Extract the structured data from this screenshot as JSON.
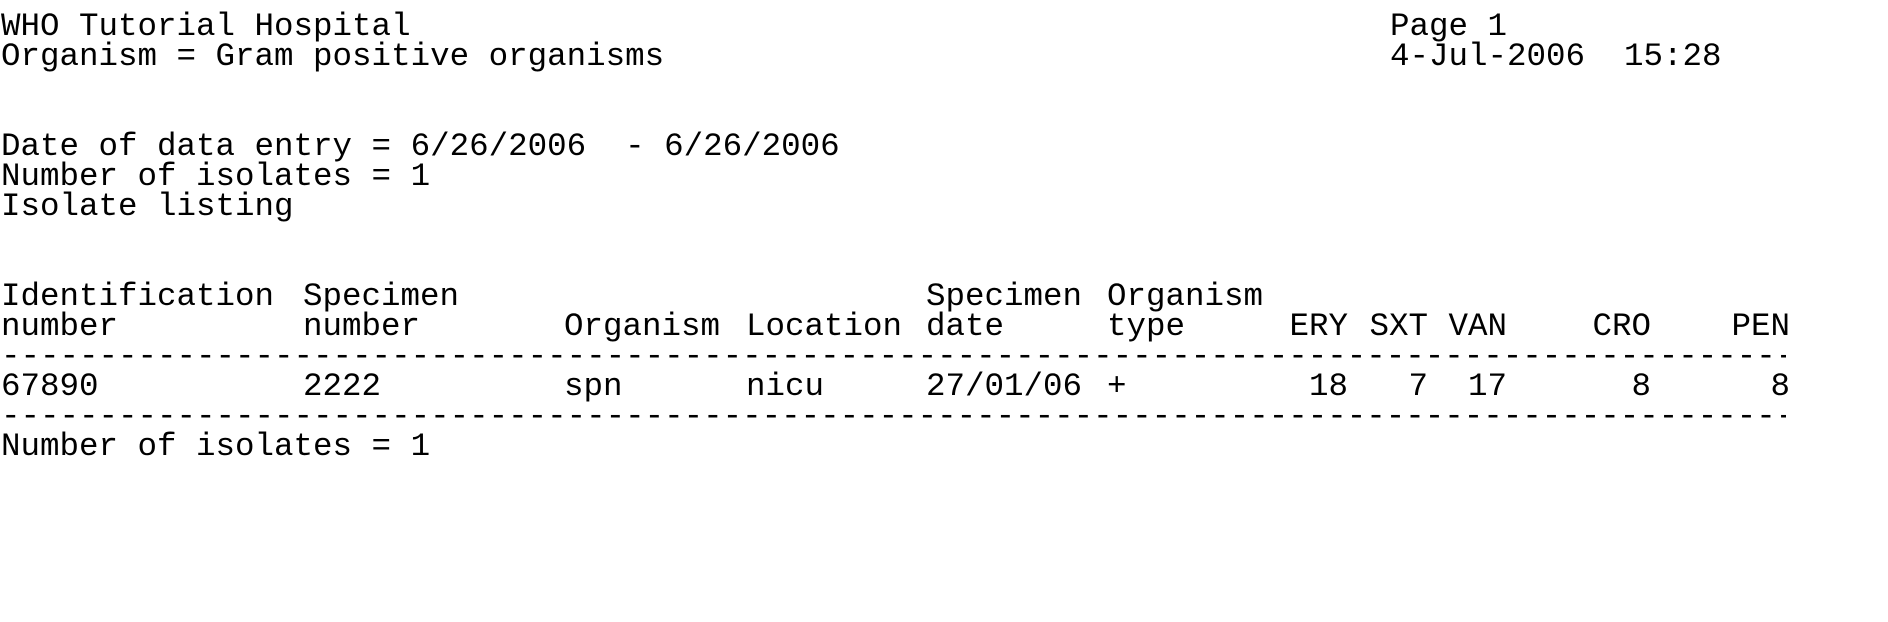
{
  "header": {
    "hospital": "WHO Tutorial Hospital",
    "organism_filter": "Organism = Gram positive organisms",
    "page": "Page 1",
    "datetime": "4-Jul-2006  15:28"
  },
  "summary": {
    "date_range": "Date of data entry = 6/26/2006  - 6/26/2006",
    "isolate_count": "Number of isolates = 1",
    "listing_title": "Isolate listing"
  },
  "table": {
    "headers_line1": {
      "identification": "Identification",
      "specimen": "Specimen",
      "specimen_date": "Specimen",
      "organism": "Organism"
    },
    "headers_line2": {
      "identification": "number",
      "specimen": "number",
      "organism": "Organism",
      "location": "Location",
      "specimen_date": "date",
      "organism_type": "type",
      "ery": "ERY",
      "sxt": "SXT",
      "van": "VAN",
      "cro": "CRO",
      "pen": "PEN"
    },
    "separator": "---------------------------------------------------------------------------------------------",
    "rows": [
      {
        "identification": "67890",
        "specimen": "2222",
        "organism": "spn",
        "location": "nicu",
        "specimen_date": "27/01/06",
        "organism_type": "+",
        "ery": "18",
        "sxt": "7",
        "van": "17",
        "cro": "8",
        "pen": "8"
      }
    ]
  },
  "footer": {
    "isolate_count": "Number of isolates = 1"
  }
}
